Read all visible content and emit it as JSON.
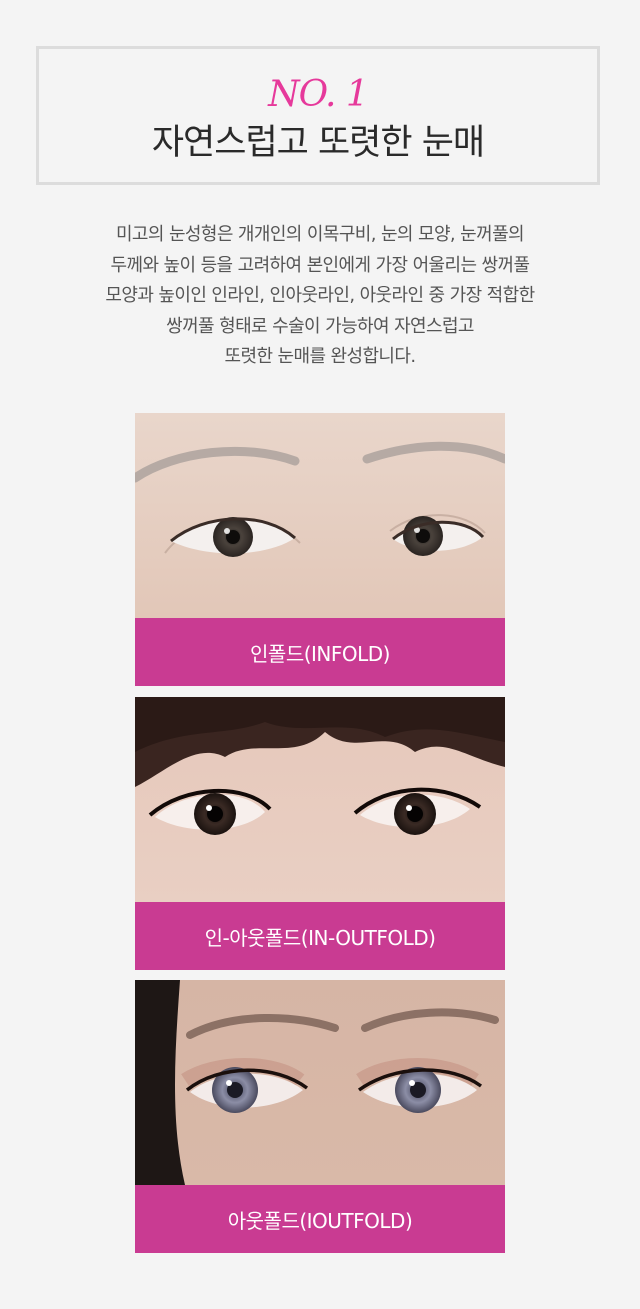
{
  "header": {
    "number": "NO. 1",
    "title": "자연스럽고 또렷한 눈매"
  },
  "description": {
    "lines": [
      "미고의 눈성형은 개개인의 이목구비, 눈의 모양, 눈꺼풀의",
      "두께와 높이 등을 고려하여 본인에게 가장 어울리는 쌍꺼풀",
      "모양과 높이인 인라인, 인아웃라인, 아웃라인 중 가장 적합한",
      "쌍꺼풀 형태로 수술이 가능하여 자연스럽고",
      "또렷한 눈매를 완성합니다."
    ]
  },
  "cards": [
    {
      "label": "인폴드(INFOLD)"
    },
    {
      "label": "인-아웃폴드(IN-OUTFOLD)"
    },
    {
      "label": "아웃폴드(IOUTFOLD)"
    }
  ],
  "colors": {
    "accent": "#e6399b",
    "label_bar": "#c93b92",
    "background": "#f4f4f4",
    "border": "#dcdcdc",
    "body_text": "#555555"
  }
}
